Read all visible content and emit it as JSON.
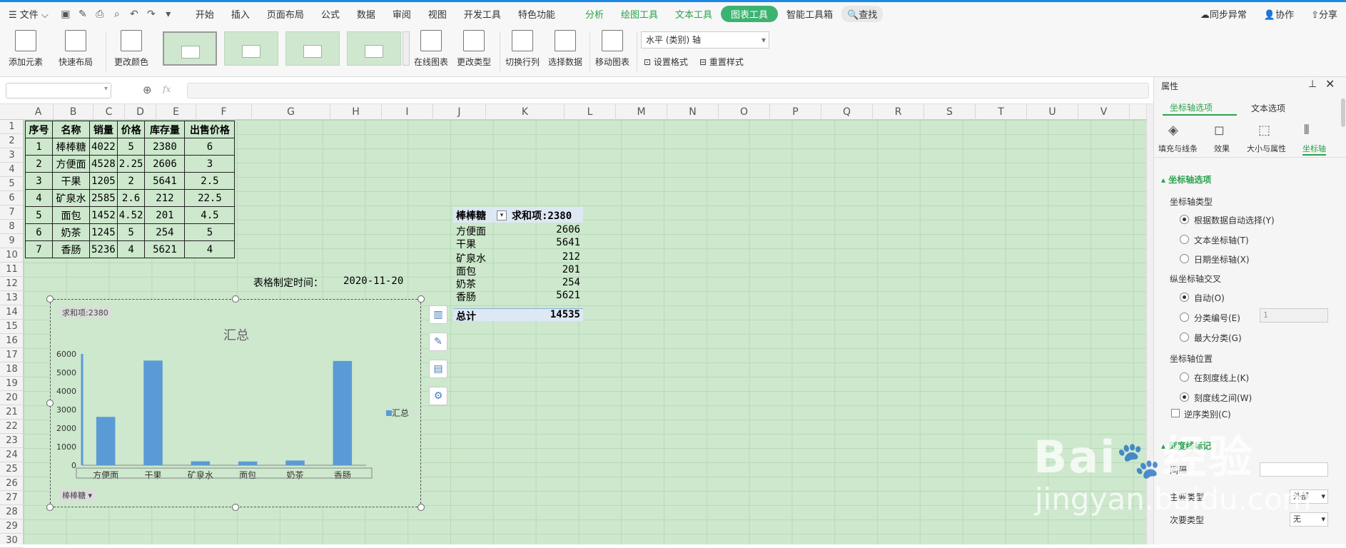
{
  "menubar": {
    "file": "文件",
    "tabs": [
      "开始",
      "插入",
      "页面布局",
      "公式",
      "数据",
      "审阅",
      "视图",
      "开发工具",
      "特色功能"
    ],
    "context_tabs": [
      "分析",
      "绘图工具",
      "文本工具"
    ],
    "active_tab": "图表工具",
    "ai_tab": "智能工具箱",
    "search": "查找",
    "sync": "同步异常",
    "collab": "协作",
    "share": "分享"
  },
  "ribbon": {
    "add_element": "添加元素",
    "quick_layout": "快速布局",
    "change_color": "更改颜色",
    "online_chart": "在线图表",
    "change_type": "更改类型",
    "switch_row_col": "切换行列",
    "select_data": "选择数据",
    "move_chart": "移动图表",
    "axis_select": "水平 (类别) 轴",
    "set_format": "设置格式",
    "reset_style": "重置样式"
  },
  "formula": {
    "fx": "fx",
    "value": ""
  },
  "columns": [
    "A",
    "B",
    "C",
    "D",
    "E",
    "F",
    "G",
    "H",
    "I",
    "J",
    "K",
    "L",
    "M",
    "N",
    "O",
    "P",
    "Q",
    "R",
    "S",
    "T",
    "U",
    "V"
  ],
  "rows": [
    "1",
    "2",
    "3",
    "4",
    "5",
    "6",
    "7",
    "8",
    "9",
    "10",
    "11",
    "12",
    "13",
    "14",
    "15",
    "16",
    "17",
    "18",
    "19",
    "20",
    "21",
    "22",
    "23",
    "24",
    "25",
    "26",
    "27",
    "28",
    "29",
    "30"
  ],
  "table": {
    "headers": [
      "序号",
      "名称",
      "销量",
      "价格",
      "库存量",
      "出售价格"
    ],
    "rows": [
      [
        "1",
        "棒棒糖",
        "4022",
        "5",
        "2380",
        "6"
      ],
      [
        "2",
        "方便面",
        "4528",
        "2.25",
        "2606",
        "3"
      ],
      [
        "3",
        "干果",
        "1205",
        "2",
        "5641",
        "2.5"
      ],
      [
        "4",
        "矿泉水",
        "2585",
        "2.6",
        "212",
        "22.5"
      ],
      [
        "5",
        "面包",
        "1452",
        "4.52",
        "201",
        "4.5"
      ],
      [
        "6",
        "奶茶",
        "1245",
        "5",
        "254",
        "5"
      ],
      [
        "7",
        "香肠",
        "5236",
        "4",
        "5621",
        "4"
      ]
    ]
  },
  "made_time": {
    "label": "表格制定时间：",
    "value": "2020-11-20"
  },
  "pivot": {
    "filter_field": "棒棒糖",
    "sum_label": "求和项:2380",
    "items": [
      [
        "方便面",
        "2606"
      ],
      [
        "干果",
        "5641"
      ],
      [
        "矿泉水",
        "212"
      ],
      [
        "面包",
        "201"
      ],
      [
        "奶茶",
        "254"
      ],
      [
        "香肠",
        "5621"
      ]
    ],
    "total_label": "总计",
    "total_value": "14535"
  },
  "chart_data": {
    "type": "bar",
    "title": "汇总",
    "field_button": "求和项:2380",
    "filter_button": "棒棒糖",
    "categories": [
      "方便面",
      "干果",
      "矿泉水",
      "面包",
      "奶茶",
      "香肠"
    ],
    "series": [
      {
        "name": "汇总",
        "values": [
          2606,
          5641,
          212,
          201,
          254,
          5621
        ],
        "color": "#5b9bd5"
      }
    ],
    "yticks": [
      "0",
      "1000",
      "2000",
      "3000",
      "4000",
      "5000",
      "6000"
    ],
    "ylim": [
      0,
      6000
    ],
    "legend": "right",
    "grid": false
  },
  "panel": {
    "title": "属性",
    "tab_axis": "坐标轴选项",
    "tab_text": "文本选项",
    "icon_tabs": [
      "填充与线条",
      "效果",
      "大小与属性",
      "坐标轴"
    ],
    "section": "坐标轴选项",
    "axis_type_label": "坐标轴类型",
    "axis_type_opts": [
      "根据数据自动选择(Y)",
      "文本坐标轴(T)",
      "日期坐标轴(X)"
    ],
    "cross_label": "纵坐标轴交叉",
    "cross_opts": [
      "自动(O)",
      "分类编号(E)",
      "最大分类(G)"
    ],
    "cross_value": "1",
    "pos_label": "坐标轴位置",
    "pos_opts": [
      "在刻度线上(K)",
      "刻度线之间(W)"
    ],
    "reverse": "逆序类别(C)",
    "tick_section": "刻度线标记",
    "interval_label": "间隔",
    "main_type_label": "主要类型",
    "main_type_value": "外部",
    "minor_type_label": "次要类型",
    "minor_type_value": "无"
  },
  "watermark": {
    "brand": "Bai",
    "brand2": "经验",
    "url": "jingyan.baidu.com"
  }
}
